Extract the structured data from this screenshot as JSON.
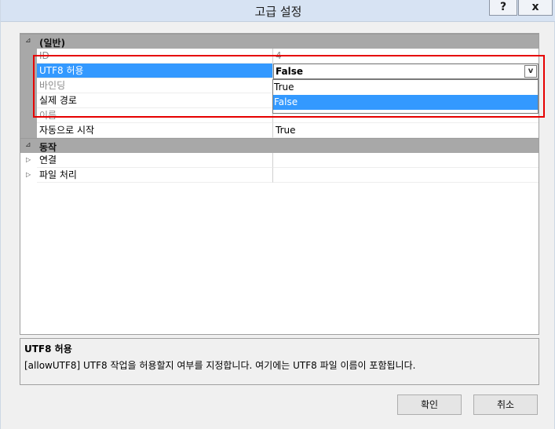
{
  "window": {
    "title": "고급 설정",
    "help_label": "?",
    "close_label": "x"
  },
  "grid": {
    "categories": [
      {
        "label": "(일반)",
        "toggle": "⊿"
      },
      {
        "label": "동작",
        "toggle": "⊿"
      }
    ],
    "general": [
      {
        "name": "ID",
        "value": "4"
      },
      {
        "name": "UTF8 허용",
        "value": "False"
      },
      {
        "name": "바인딩",
        "value": ""
      },
      {
        "name": "실제 경로",
        "value": ""
      },
      {
        "name": "이름",
        "value": ""
      },
      {
        "name": "자동으로 시작",
        "value": "True"
      }
    ],
    "behavior": [
      {
        "name": "연결",
        "value": "",
        "expander": "▷"
      },
      {
        "name": "파일 처리",
        "value": "",
        "expander": "▷"
      }
    ],
    "combo_arrow": "v",
    "dropdown_options": [
      "True",
      "False"
    ]
  },
  "description": {
    "title": "UTF8 허용",
    "text": "[allowUTF8] UTF8 작업을 허용할지 여부를 지정합니다. 여기에는 UTF8 파일 이름이 포함됩니다."
  },
  "buttons": {
    "ok": "확인",
    "cancel": "취소"
  },
  "colors": {
    "selection": "#3399ff",
    "highlight_box": "#e60000",
    "category_band": "#a8a8a8"
  }
}
